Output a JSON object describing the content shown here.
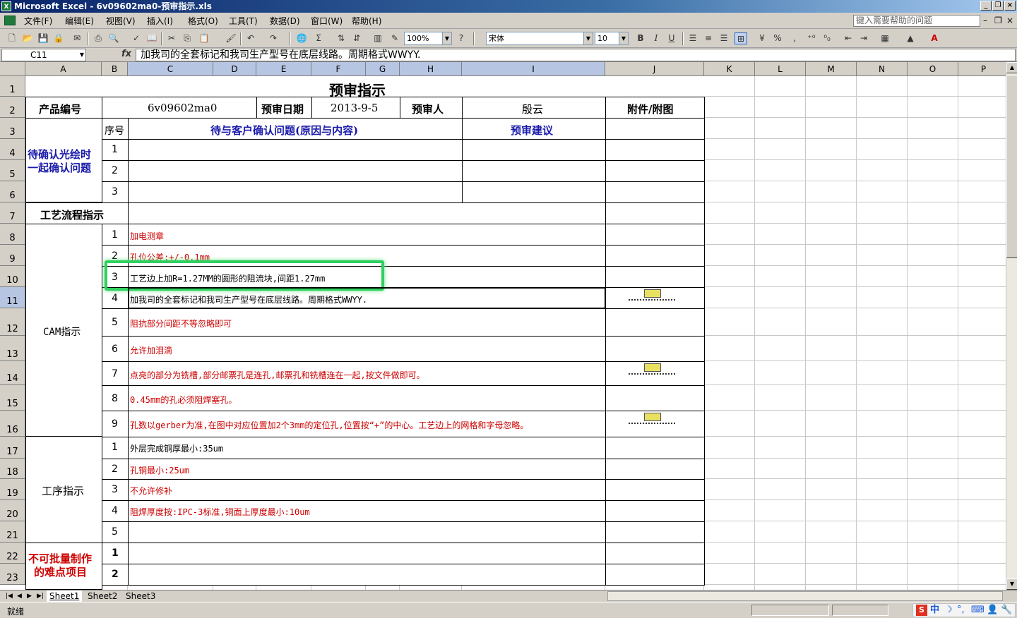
{
  "window": {
    "title": "Microsoft Excel - 6v09602ma0-预审指示.xls",
    "app_icon_letter": "X"
  },
  "menu": {
    "items": [
      "文件(F)",
      "编辑(E)",
      "视图(V)",
      "插入(I)",
      "格式(O)",
      "工具(T)",
      "数据(D)",
      "窗口(W)",
      "帮助(H)"
    ],
    "help_placeholder": "键入需要帮助的问题"
  },
  "toolbar": {
    "zoom": "100%",
    "font": "宋体",
    "size": "10",
    "bold": "B",
    "italic": "I",
    "underline": "U",
    "percent": "%",
    "comma": ","
  },
  "formula": {
    "cell_ref": "C11",
    "fx": "fx",
    "content": "加我司的全套标记和我司生产型号在底层线路。周期格式WWYY."
  },
  "columns": [
    "A",
    "B",
    "C",
    "D",
    "E",
    "F",
    "G",
    "H",
    "I",
    "J",
    "K",
    "L",
    "M",
    "N",
    "O",
    "P"
  ],
  "rows": [
    "1",
    "2",
    "3",
    "4",
    "5",
    "6",
    "7",
    "8",
    "9",
    "10",
    "11",
    "12",
    "13",
    "14",
    "15",
    "16",
    "17",
    "18",
    "19",
    "20",
    "21",
    "22",
    "23"
  ],
  "sheet": {
    "title": "预审指示",
    "product_label": "产品编号",
    "product_value": "6v09602ma0",
    "date_label": "预审日期",
    "date_value": "2013-9-5",
    "reviewer_label": "预审人",
    "reviewer_value": "殷云",
    "attach_label": "附件/附图",
    "seq_label": "序号",
    "question_header": "待与客户确认问题(原因与内容)",
    "suggest_header": "预审建议",
    "confirm_section_line1": "待确认光绘时",
    "confirm_section_line2": "一起确认问题",
    "confirm_nums": [
      "1",
      "2",
      "3"
    ],
    "process_header": "工艺流程指示",
    "cam_section": "CAM指示",
    "cam_items": [
      {
        "n": "1",
        "text": "加电测章",
        "red": true
      },
      {
        "n": "2",
        "text": "孔位公差:+/-0.1mm",
        "red": true
      },
      {
        "n": "3",
        "text": "工艺边上加R=1.27MM的圆形的阻流块,间距1.27mm",
        "red": false
      },
      {
        "n": "4",
        "text": "加我司的全套标记和我司生产型号在底层线路。周期格式WWYY.",
        "red": false
      },
      {
        "n": "5",
        "text": "阻抗部分间距不等忽略即可",
        "red": true
      },
      {
        "n": "6",
        "text": "允许加泪滴",
        "red": true
      },
      {
        "n": "7",
        "text": "点亮的部分为铣槽,部分邮票孔是连孔,邮票孔和铣槽连在一起,按文件做即可。",
        "red": true
      },
      {
        "n": "8",
        "text": "0.45mm的孔必须阻焊塞孔。",
        "red": true
      },
      {
        "n": "9",
        "text": "孔数以gerber为准,在图中对应位置加2个3mm的定位孔,位置按“+”的中心。工艺边上的网格和字母忽略。",
        "red": true
      }
    ],
    "proc_section": "工序指示",
    "proc_items": [
      {
        "n": "1",
        "text": "外层完成铜厚最小:35um",
        "red": false
      },
      {
        "n": "2",
        "text": "孔铜最小:25um",
        "red": true
      },
      {
        "n": "3",
        "text": "不允许修补",
        "red": true
      },
      {
        "n": "4",
        "text": "阻焊厚度按:IPC-3标准,铜面上厚度最小:10um",
        "red": true
      },
      {
        "n": "5",
        "text": "",
        "red": false
      }
    ],
    "difficult_line1": "不可批量制作",
    "difficult_line2": "的难点项目",
    "difficult_nums": [
      "1",
      "2"
    ]
  },
  "sheets": [
    "Sheet1",
    "Sheet2",
    "Sheet3"
  ],
  "status": {
    "text": "就绪",
    "ime": "中"
  },
  "accent": "#0a246a",
  "highlight_color": "#30d060"
}
